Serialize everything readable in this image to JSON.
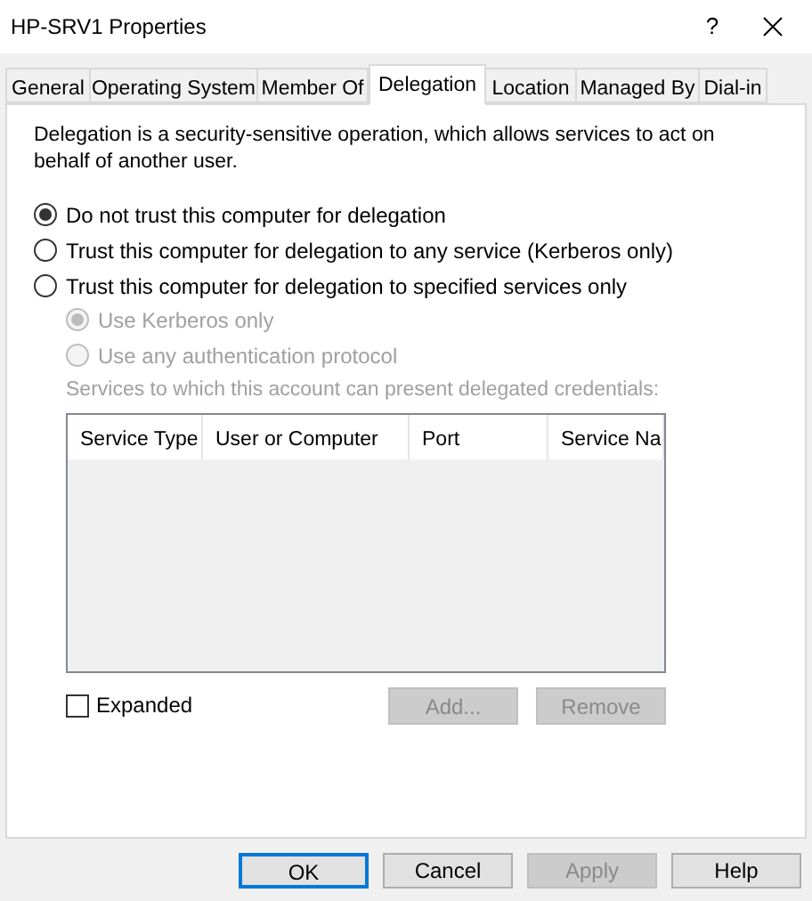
{
  "window": {
    "title": "HP-SRV1 Properties",
    "help": "?"
  },
  "tabs": [
    {
      "label": "General",
      "selected": false
    },
    {
      "label": "Operating System",
      "selected": false
    },
    {
      "label": "Member Of",
      "selected": false
    },
    {
      "label": "Delegation",
      "selected": true
    },
    {
      "label": "Location",
      "selected": false
    },
    {
      "label": "Managed By",
      "selected": false
    },
    {
      "label": "Dial-in",
      "selected": false
    }
  ],
  "description": "Delegation is a security-sensitive operation, which allows services to act on behalf of another user.",
  "trust_options": [
    {
      "label": "Do not trust this computer for delegation",
      "selected": true
    },
    {
      "label": "Trust this computer for delegation to any service (Kerberos only)",
      "selected": false
    },
    {
      "label": "Trust this computer for delegation to specified services only",
      "selected": false
    }
  ],
  "protocol_options": [
    {
      "label": "Use Kerberos only",
      "selected": true,
      "disabled": true
    },
    {
      "label": "Use any authentication protocol",
      "selected": false,
      "disabled": true
    }
  ],
  "services": {
    "label": "Services to which this account can present delegated credentials:",
    "disabled": true,
    "columns": [
      "Service Type",
      "User or Computer",
      "Port",
      "Service Na"
    ]
  },
  "expanded": {
    "label": "Expanded",
    "checked": false
  },
  "list_buttons": [
    {
      "label": "Add...",
      "disabled": true
    },
    {
      "label": "Remove",
      "disabled": true
    }
  ],
  "buttons": [
    {
      "label": "OK",
      "default": true,
      "disabled": false
    },
    {
      "label": "Cancel",
      "default": false,
      "disabled": false
    },
    {
      "label": "Apply",
      "default": false,
      "disabled": true
    },
    {
      "label": "Help",
      "default": false,
      "disabled": false
    }
  ]
}
